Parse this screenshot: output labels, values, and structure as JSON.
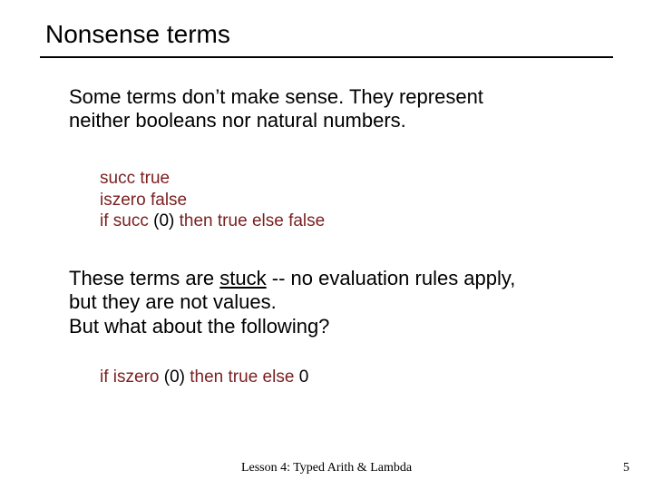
{
  "title": "Nonsense terms",
  "para1_a": "Some terms don’t make sense.  They represent",
  "para1_b": "neither booleans nor natural numbers.",
  "code1": {
    "l1_k1": "succ",
    "l1_k2": "true",
    "l2_k1": "iszero",
    "l2_k2": "false",
    "l3_k1": "if",
    "l3_k2": "succ",
    "l3_t1": "(0) ",
    "l3_k3": "then",
    "l3_k4": "true",
    "l3_k5": "else",
    "l3_k6": "false"
  },
  "para2_a_pre": "These terms are ",
  "para2_a_stuck": "stuck",
  "para2_a_post": " -- no evaluation rules apply,",
  "para2_b": "but they are not values.",
  "para2_c": "But what about the following?",
  "code2": {
    "k1": "if",
    "k2": "iszero",
    "t1": "(0) ",
    "k3": "then",
    "k4": "true",
    "k5": "else",
    "t2": " 0"
  },
  "footer_center": "Lesson 4: Typed Arith & Lambda",
  "footer_right": "5"
}
